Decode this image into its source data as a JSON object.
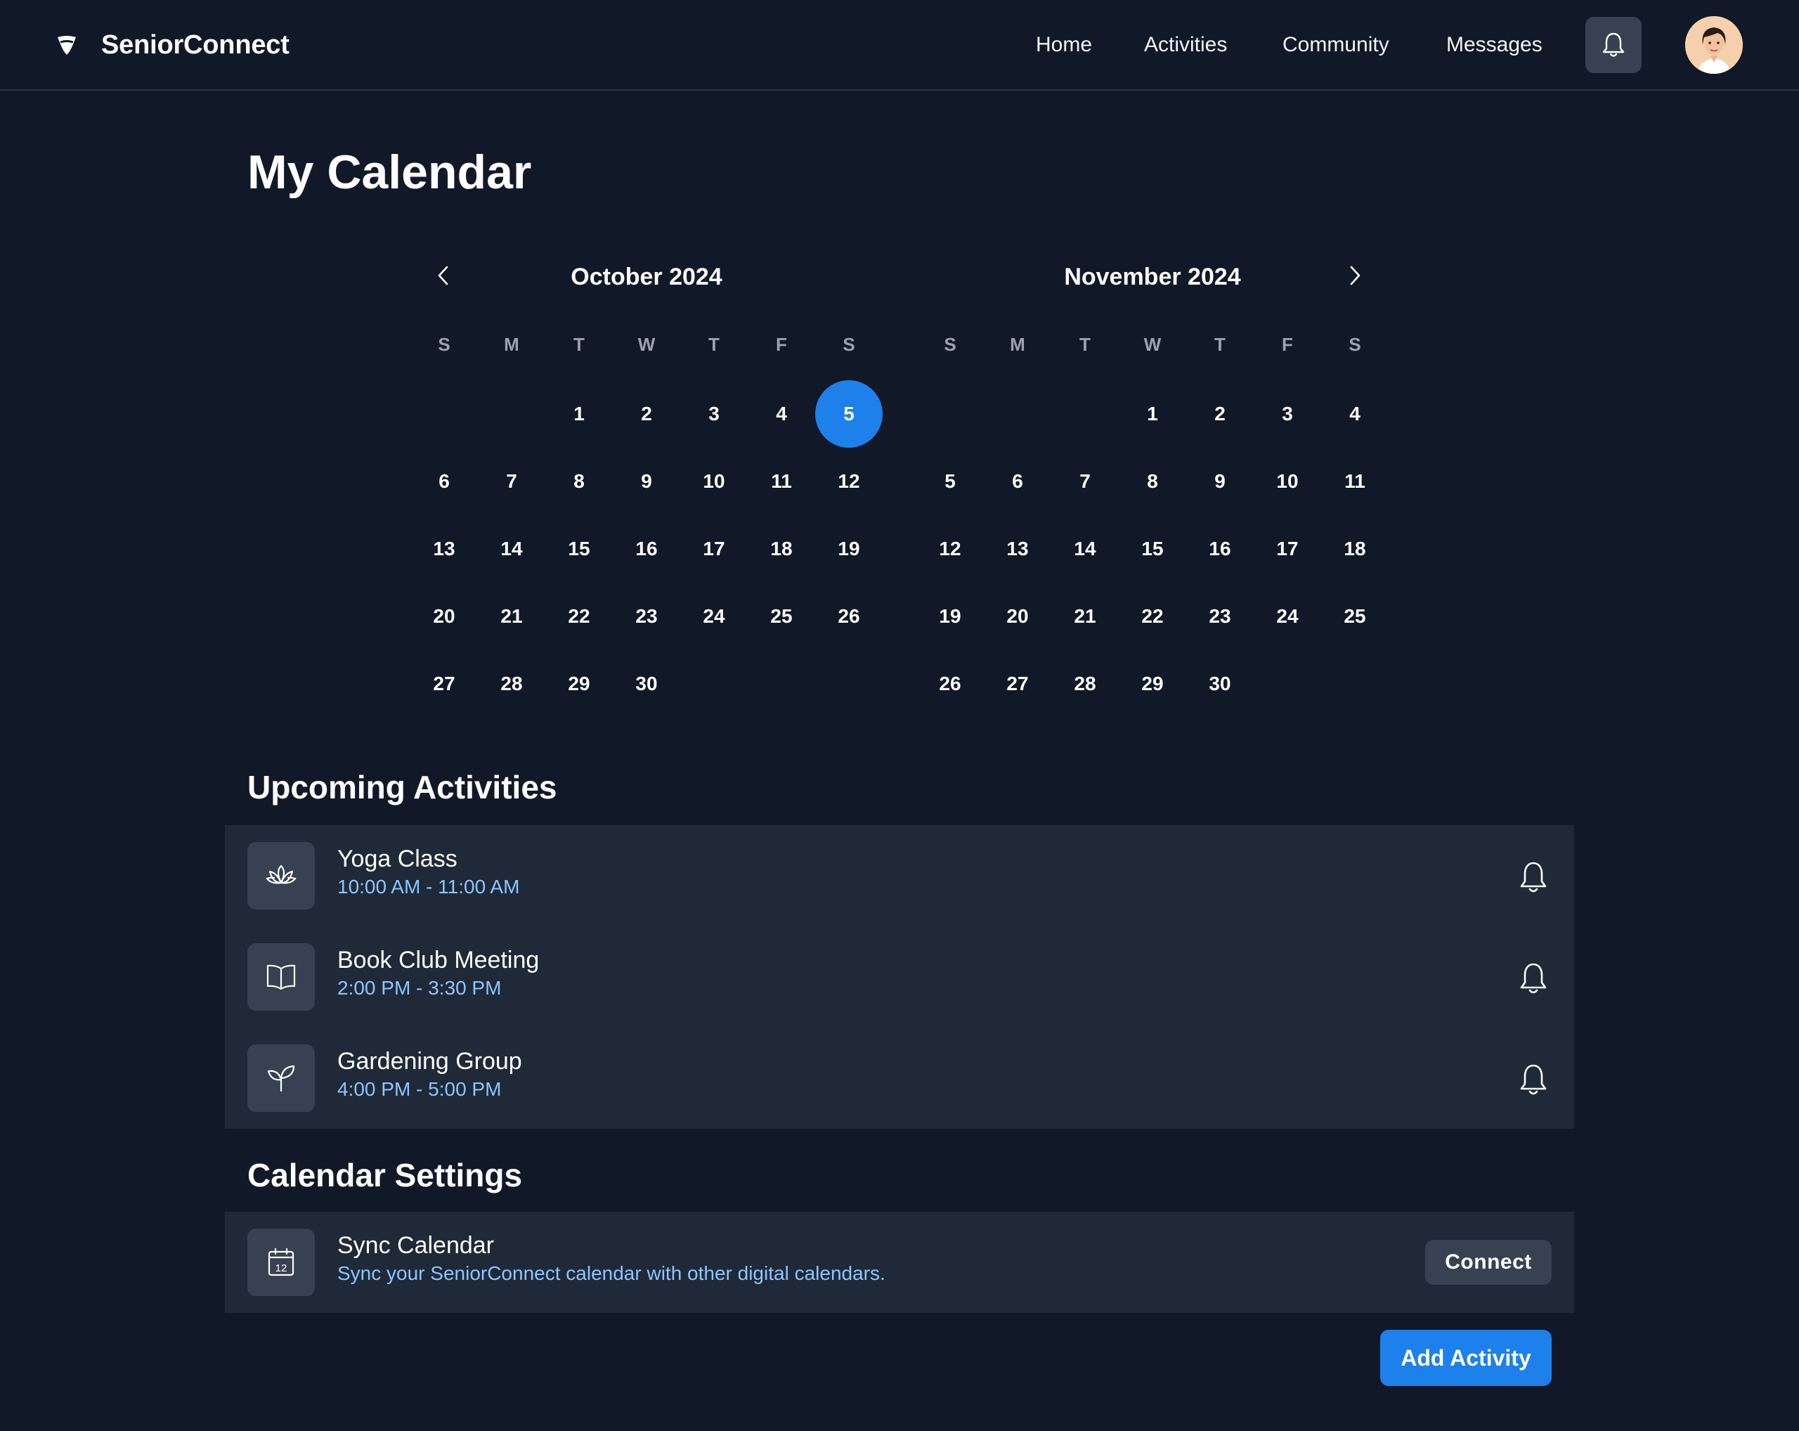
{
  "app": {
    "name": "SeniorConnect"
  },
  "nav": {
    "home": "Home",
    "activities": "Activities",
    "community": "Community",
    "messages": "Messages"
  },
  "icons": {
    "logo": "heart-shield-icon",
    "notifications": "bell-icon",
    "prev": "chevron-left-icon",
    "next": "chevron-right-icon"
  },
  "page": {
    "title": "My Calendar"
  },
  "calendar": {
    "weekday_labels": [
      "S",
      "M",
      "T",
      "W",
      "T",
      "F",
      "S"
    ],
    "selected_color": "#1e80ea",
    "months": [
      {
        "title": "October 2024",
        "first_weekday": 2,
        "days": 30,
        "selected_day": 5
      },
      {
        "title": "November 2024",
        "first_weekday": 3,
        "days": 30,
        "selected_day": null
      }
    ]
  },
  "upcoming": {
    "title": "Upcoming Activities",
    "items": [
      {
        "icon": "lotus-icon",
        "title": "Yoga Class",
        "time": "10:00 AM - 11:00 AM"
      },
      {
        "icon": "book-icon",
        "title": "Book Club Meeting",
        "time": "2:00 PM - 3:30 PM"
      },
      {
        "icon": "sprout-icon",
        "title": "Gardening Group",
        "time": "4:00 PM - 5:00 PM"
      }
    ]
  },
  "settings": {
    "title": "Calendar Settings",
    "sync": {
      "icon": "calendar-icon",
      "icon_text": "12",
      "title": "Sync Calendar",
      "description": "Sync your SeniorConnect calendar with other digital calendars.",
      "button": "Connect"
    }
  },
  "actions": {
    "add_activity": "Add Activity"
  },
  "colors": {
    "background": "#111827",
    "panel": "#1f2937",
    "accent": "#1e80ea",
    "subtext": "#8ec5ff"
  }
}
